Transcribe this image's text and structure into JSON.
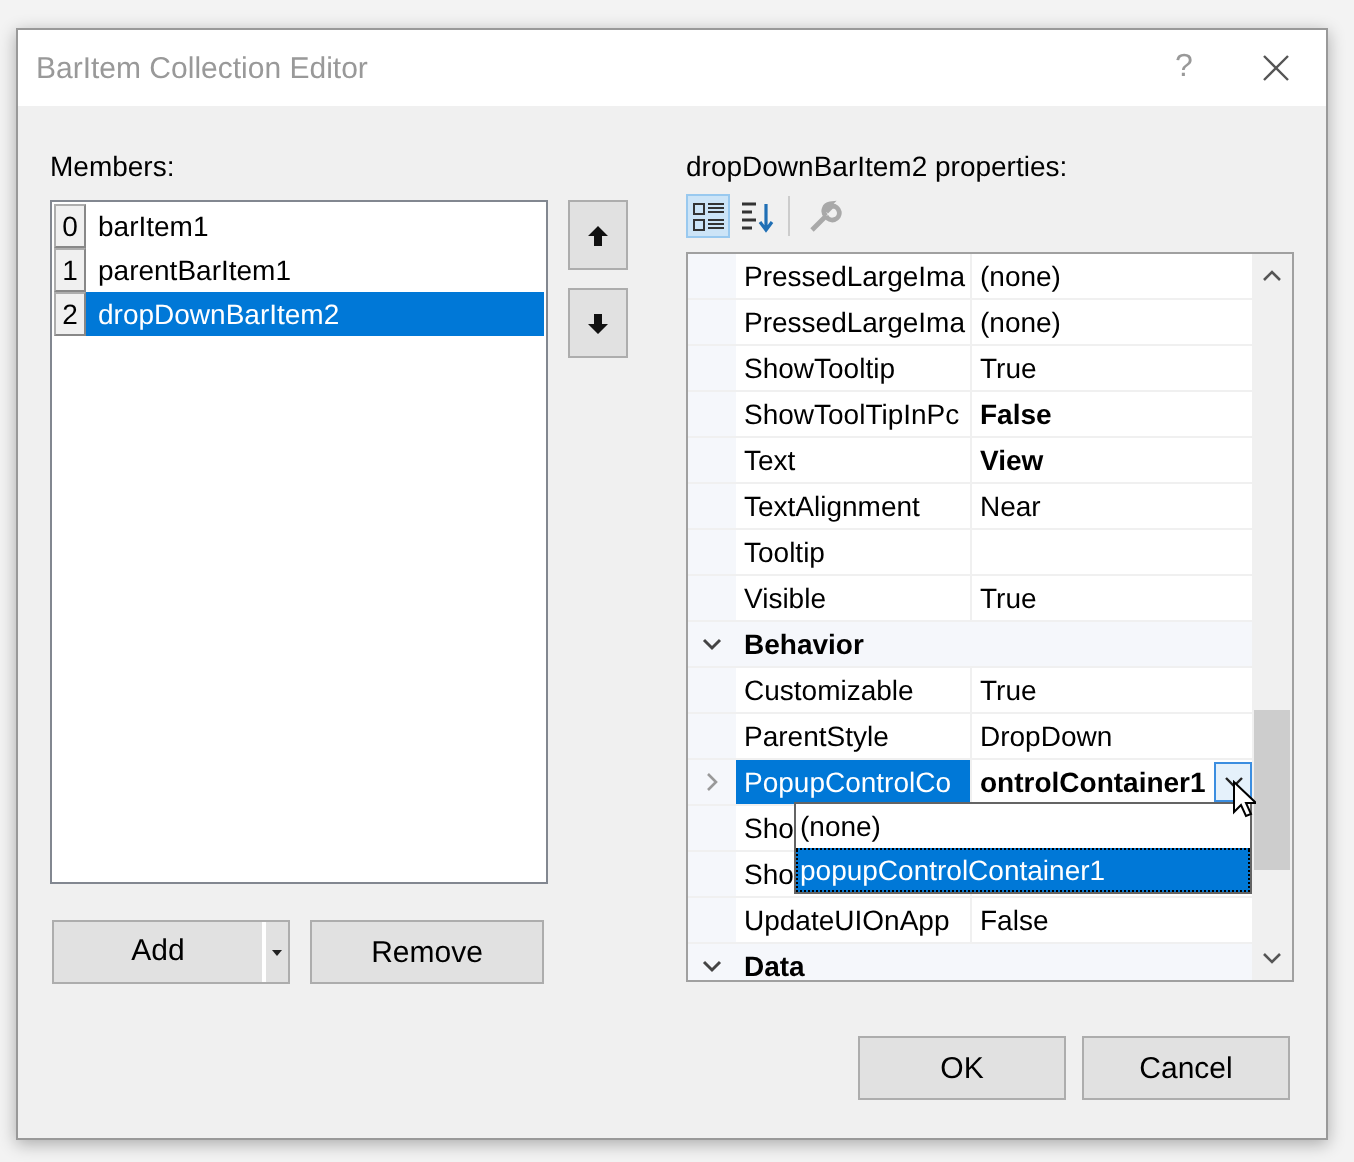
{
  "window": {
    "title": "BarItem Collection Editor",
    "help": "?"
  },
  "members": {
    "label": "Members:",
    "items": [
      {
        "index": "0",
        "name": "barItem1",
        "selected": false
      },
      {
        "index": "1",
        "name": "parentBarItem1",
        "selected": false
      },
      {
        "index": "2",
        "name": "dropDownBarItem2",
        "selected": true
      }
    ],
    "buttons": [
      {
        "label": "Add",
        "kind": "split"
      },
      {
        "label": "Remove",
        "kind": "plain"
      }
    ]
  },
  "properties": {
    "label": "dropDownBarItem2 properties:",
    "toolbar": [
      {
        "kind": "categorized",
        "selected": true,
        "disabled": false
      },
      {
        "kind": "alphabetical",
        "selected": false,
        "disabled": false
      },
      {
        "kind": "property-pages",
        "selected": false,
        "disabled": true
      }
    ],
    "rows": [
      {
        "kind": "property",
        "name": "PressedLargeIma",
        "value": "(none)",
        "modified": false,
        "selected": false,
        "expandable": false
      },
      {
        "kind": "property",
        "name": "PressedLargeIma",
        "value": "(none)",
        "modified": false,
        "selected": false,
        "expandable": false
      },
      {
        "kind": "property",
        "name": "ShowTooltip",
        "value": "True",
        "modified": false,
        "selected": false
      },
      {
        "kind": "property",
        "name": "ShowToolTipInPc",
        "value": "False",
        "modified": true,
        "selected": false
      },
      {
        "kind": "property",
        "name": "Text",
        "value": "View",
        "modified": true,
        "selected": false
      },
      {
        "kind": "property",
        "name": "TextAlignment",
        "value": "Near",
        "modified": false,
        "selected": false
      },
      {
        "kind": "property",
        "name": "Tooltip",
        "selected": false
      },
      {
        "kind": "property",
        "name": "Visible",
        "value": "True",
        "modified": false,
        "selected": false
      },
      {
        "kind": "category",
        "name": "Behavior",
        "expanded": true
      },
      {
        "kind": "property",
        "name": "Customizable",
        "value": "True",
        "modified": false,
        "selected": false
      },
      {
        "kind": "property",
        "name": "ParentStyle",
        "value": "DropDown",
        "modified": false,
        "selected": false
      },
      {
        "kind": "property",
        "name": "PopupControlCo",
        "value": "ontrolContainer1",
        "modified": true,
        "selected": true,
        "expandable": true
      },
      {
        "kind": "property",
        "name": "Sho",
        "selected": false
      },
      {
        "kind": "property",
        "name": "Sho",
        "selected": false
      },
      {
        "kind": "property",
        "name": "UpdateUIOnApp",
        "value": "False",
        "modified": false,
        "selected": false
      },
      {
        "kind": "category",
        "name": "Data",
        "expanded": true
      }
    ],
    "dropdown": [
      {
        "label": "(none)",
        "selected": false
      },
      {
        "label": "popupControlContainer1",
        "selected": true
      }
    ]
  },
  "buttons": [
    {
      "label": "OK"
    },
    {
      "label": "Cancel"
    }
  ]
}
